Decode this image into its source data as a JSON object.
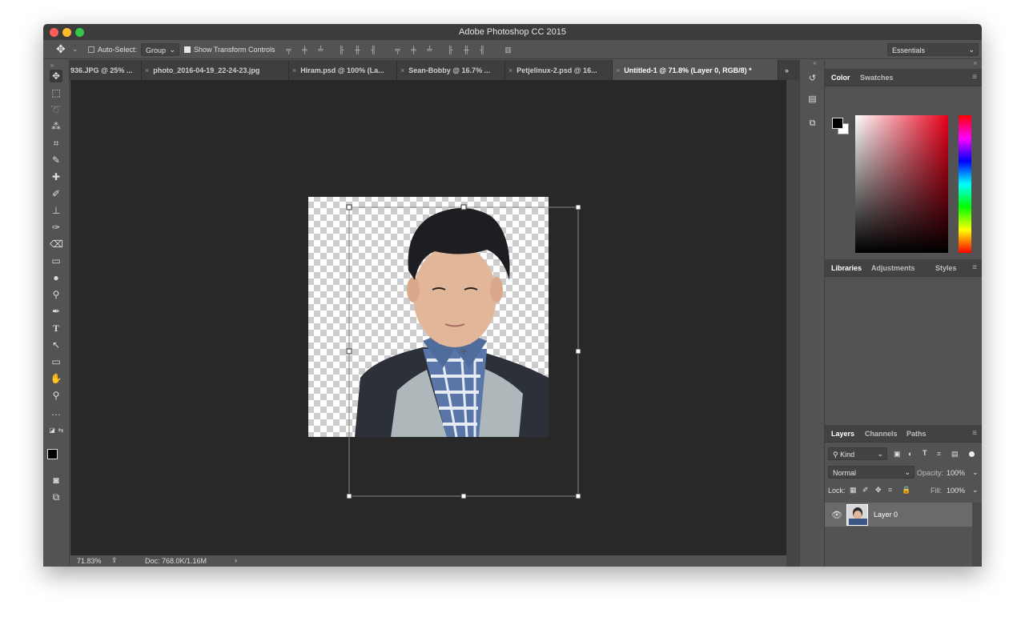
{
  "window": {
    "title": "Adobe Photoshop CC 2015"
  },
  "options_bar": {
    "auto_select_label": "Auto-Select:",
    "auto_select_value": "Group",
    "show_transform_label": "Show Transform Controls",
    "workspace": "Essentials"
  },
  "tabs": [
    {
      "label": "936.JPG @ 25% ..."
    },
    {
      "label": "photo_2016-04-19_22-24-23.jpg"
    },
    {
      "label": "Hiram.psd @ 100% (La..."
    },
    {
      "label": "Sean-Bobby @ 16.7% ..."
    },
    {
      "label": "Petjelinux-2.psd @ 16..."
    },
    {
      "label": "Untitled-1 @ 71.8% (Layer 0, RGB/8) *"
    }
  ],
  "status": {
    "zoom": "71.83%",
    "doc": "Doc: 768.0K/1.16M"
  },
  "panels": {
    "color_tabs": [
      "Color",
      "Swatches"
    ],
    "libraries_tabs": [
      "Libraries",
      "Adjustments",
      "Styles"
    ],
    "layers_tabs": [
      "Layers",
      "Channels",
      "Paths"
    ],
    "kind_label": "Kind",
    "blend_mode": "Normal",
    "opacity_label": "Opacity:",
    "opacity_value": "100%",
    "lock_label": "Lock:",
    "fill_label": "Fill:",
    "fill_value": "100%",
    "layer_name": "Layer 0"
  },
  "colors": {
    "accent": "#e8e8e8",
    "traffic_red": "#fc5f57",
    "traffic_yellow": "#fdbc2e",
    "traffic_green": "#33c748"
  }
}
